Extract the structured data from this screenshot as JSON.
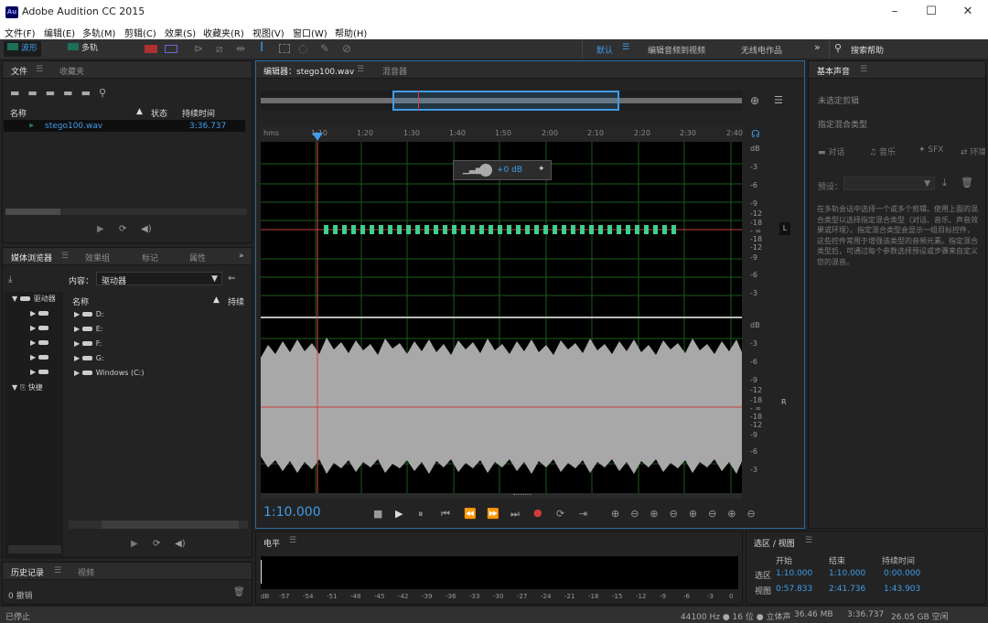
{
  "app": {
    "title": "Adobe Audition CC 2015",
    "logo": "Au"
  },
  "menu": [
    "文件(F)",
    "编辑(E)",
    "多轨(M)",
    "剪辑(C)",
    "效果(S)",
    "收藏夹(R)",
    "视图(V)",
    "窗口(W)",
    "帮助(H)"
  ],
  "toolbar": {
    "waveform": "波形",
    "multitrack": "多轨",
    "workspace": "默认",
    "workspace2": "编辑音频到视频",
    "workspace3": "无线电作品",
    "search": "搜索帮助"
  },
  "files_panel": {
    "tabs": [
      "文件",
      "收藏夹"
    ],
    "columns": {
      "name": "名称",
      "status": "状态",
      "duration": "持续时间"
    },
    "rows": [
      {
        "name": "stego100.wav",
        "duration": "3:36.737"
      }
    ]
  },
  "media_browser": {
    "tabs": [
      "媒体浏览器",
      "效果组",
      "标记",
      "属性"
    ],
    "content_label": "内容：",
    "content_value": "驱动器",
    "name_col": "名称",
    "duration_col": "持续",
    "left_tree": [
      "驱动器",
      "快捷"
    ],
    "drives": [
      "D:",
      "E:",
      "F:",
      "G:",
      "Windows (C:)"
    ]
  },
  "history_panel": {
    "tabs": [
      "历史记录",
      "视频"
    ],
    "undo": "0 撤销"
  },
  "editor": {
    "tabs": [
      "编辑器：stego100.wav",
      "混音器"
    ],
    "ruler": [
      "hms",
      "1:10",
      "1:20",
      "1:30",
      "1:40",
      "1:50",
      "2:00",
      "2:10",
      "2:20",
      "2:30",
      "2:40"
    ],
    "hud_gain": "+0 dB",
    "db_top": [
      "dB",
      "-3",
      "-6",
      "-9",
      "-12",
      "-18",
      "- ∞",
      "-18",
      "-12",
      "-9",
      "-6",
      "-3"
    ],
    "db_bottom": [
      "dB",
      "-3",
      "-6",
      "-9",
      "-12",
      "-18",
      "- ∞",
      "-18",
      "-12",
      "-9",
      "-6",
      "-3"
    ],
    "channel_left": "L",
    "channel_right": "R",
    "time": "1:10.000"
  },
  "levels": {
    "title": "电平",
    "scale": [
      "dB",
      "-57",
      "-54",
      "-51",
      "-48",
      "-45",
      "-42",
      "-39",
      "-36",
      "-33",
      "-30",
      "-27",
      "-24",
      "-21",
      "-18",
      "-15",
      "-12",
      "-9",
      "-6",
      "-3",
      "0"
    ]
  },
  "selection": {
    "title": "选区 / 视图",
    "headers": [
      "开始",
      "结束",
      "持续时间"
    ],
    "rows": [
      {
        "label": "选区",
        "start": "1:10.000",
        "end": "1:10.000",
        "duration": "0:00.000"
      },
      {
        "label": "视图",
        "start": "0:57.833",
        "end": "2:41.736",
        "duration": "1:43.903"
      }
    ]
  },
  "essential_sound": {
    "title": "基本声音",
    "no_clip": "未选定剪辑",
    "mix_type": "指定混合类型",
    "tabs": [
      "对话",
      "音乐",
      "SFX",
      "环境"
    ],
    "preset_label": "预设：",
    "desc": "在多轨会话中选择一个或多个剪辑。使用上面的混合类型以选择指定混合类型（对话、音乐、声音效果或环境）。指定混合类型会显示一组目标控件，这些控件常用于增强该类型的音频元素。指定混合类型后，可通过每个参数选择预设或步骤来自定义您的混音。"
  },
  "status": {
    "left": "已停止",
    "sample": "44100 Hz ● 16 位 ● 立体声",
    "size": "36.46 MB",
    "duration": "3:36.737",
    "free": "26.05 GB 空闲"
  },
  "colors": {
    "accent": "#3f9ce8",
    "wave": "#a8a8a8",
    "playhead": "#e04040",
    "marker": "#3ecf8e",
    "title_blue": "#2a5fa8"
  }
}
